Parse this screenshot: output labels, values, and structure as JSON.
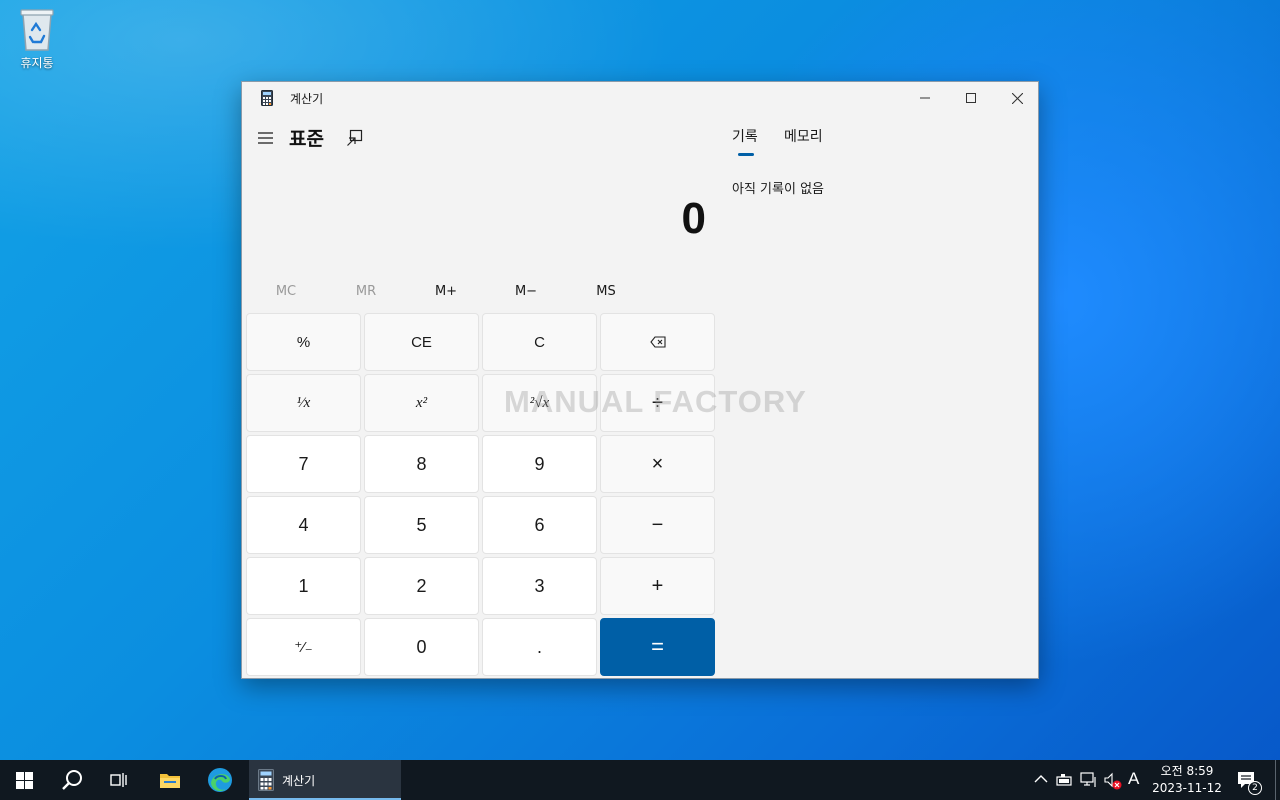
{
  "desktop": {
    "recycle_bin_label": "휴지통"
  },
  "window": {
    "title": "계산기",
    "mode_title": "표준",
    "display_value": "0",
    "watermark": "MANUAL FACTORY",
    "memory_buttons": [
      {
        "label": "MC",
        "enabled": false
      },
      {
        "label": "MR",
        "enabled": false
      },
      {
        "label": "M+",
        "enabled": true
      },
      {
        "label": "M−",
        "enabled": true
      },
      {
        "label": "MS",
        "enabled": true
      }
    ],
    "keys": {
      "percent": "%",
      "ce": "CE",
      "c": "C",
      "reciprocal": "¹⁄x",
      "square": "x²",
      "sqrt": "²√x",
      "divide": "÷",
      "seven": "7",
      "eight": "8",
      "nine": "9",
      "multiply": "×",
      "four": "4",
      "five": "5",
      "six": "6",
      "minus": "−",
      "one": "1",
      "two": "2",
      "three": "3",
      "plus": "+",
      "negate": "⁺⁄₋",
      "zero": "0",
      "decimal": ".",
      "equals": "="
    },
    "side_tabs": {
      "history": "기록",
      "memory": "메모리"
    },
    "history_empty": "아직 기록이 없음"
  },
  "taskbar": {
    "calc_label": "계산기",
    "clock_time": "오전 8:59",
    "clock_date": "2023-11-12",
    "ime_indicator": "A",
    "notification_count": "2"
  },
  "colors": {
    "accent": "#005fa6",
    "taskbar": "#101820"
  }
}
